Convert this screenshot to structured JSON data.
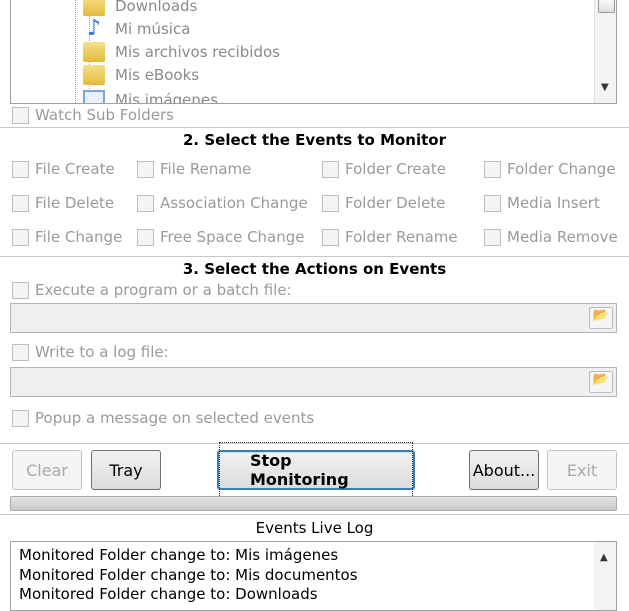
{
  "tree": {
    "items": [
      {
        "label": "Downloads",
        "icon": "folder-icon"
      },
      {
        "label": "Mi música",
        "icon": "music-icon"
      },
      {
        "label": "Mis archivos recibidos",
        "icon": "folder-icon"
      },
      {
        "label": "Mis eBooks",
        "icon": "folder-icon"
      },
      {
        "label": "Mis imágenes",
        "icon": "pictures-folder-icon"
      }
    ]
  },
  "watch_sub_folders": "Watch Sub Folders",
  "events": {
    "heading": "2. Select the Events to Monitor",
    "items": [
      "File Create",
      "File Rename",
      "Folder Create",
      "Folder Change",
      "File Delete",
      "Association Change",
      "Folder Delete",
      "Media Insert",
      "File Change",
      "Free Space Change",
      "Folder Rename",
      "Media Remove"
    ]
  },
  "actions": {
    "heading": "3. Select the Actions on Events",
    "execute": "Execute a program or a batch file:",
    "execute_value": "",
    "log": "Write to a log file:",
    "log_value": "",
    "popup": "Popup a message on selected events"
  },
  "buttons": {
    "clear": "Clear",
    "tray": "Tray",
    "stop": "Stop Monitoring",
    "about": "About...",
    "exit": "Exit"
  },
  "progress": 0,
  "live_log": {
    "heading": "Events Live Log",
    "lines": [
      "Monitored Folder change to: Mis imágenes",
      "Monitored Folder change to: Mis documentos",
      "Monitored Folder change to: Downloads"
    ]
  }
}
